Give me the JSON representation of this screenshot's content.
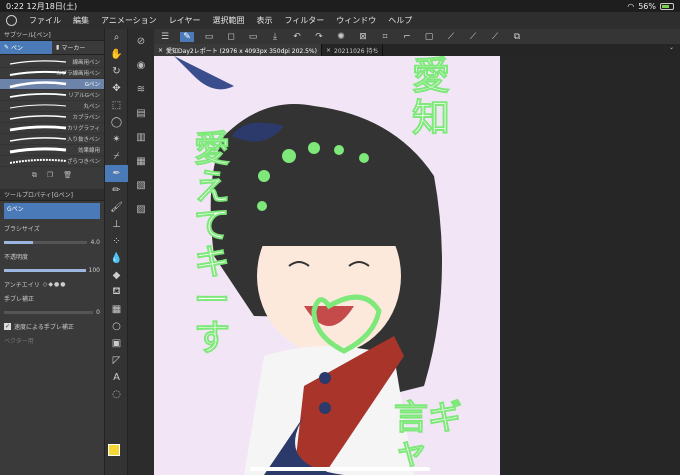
{
  "status": {
    "time": "0:22",
    "date": "12月18日(土)",
    "battery": "56%"
  },
  "menu": [
    "ファイル",
    "編集",
    "アニメーション",
    "レイヤー",
    "選択範囲",
    "表示",
    "フィルター",
    "ウィンドウ",
    "ヘルプ"
  ],
  "subtool": {
    "title": "サブツール[ペン]",
    "tabs": [
      "ペン",
      "マーカー"
    ],
    "brushes": [
      "線画用ペン",
      "カプラ線画用ペン",
      "Gペン",
      "リアルGペン",
      "丸ペン",
      "カブラペン",
      "カリグラフィ",
      "入り抜きペン",
      "効果線用",
      "ざらつきペン"
    ]
  },
  "toolprop": {
    "title": "ツールプロパティ[Gペン]",
    "brush_name": "Gペン",
    "brush_size_label": "ブラシサイズ",
    "brush_size": "4.0",
    "opacity_label": "不透明度",
    "opacity": "100",
    "antialias_label": "アンチエイリ",
    "stabilization_label": "手ブレ補正",
    "stabilization": "0",
    "speed_label": "速度による手ブレ補正",
    "vector_label": "ベクター用"
  },
  "tabs": [
    {
      "label": "愛知Day2レポート (2976 x 4093px 350dpi 202.5%)"
    },
    {
      "label": "20211026 持ち"
    }
  ],
  "artwork": {
    "text_top": "愛知",
    "text_left": "愛えてキーす",
    "text_right": "言ギャ"
  },
  "colors": {
    "accent": "#4a7bb8",
    "fg_swatch": "#f5d834",
    "canvas_bg": "#f2e6f6",
    "handwriting": "#7ee87a"
  }
}
